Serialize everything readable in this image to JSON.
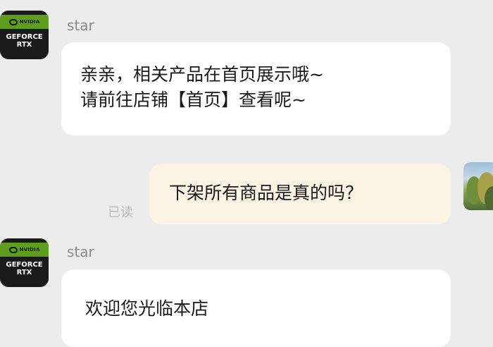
{
  "conversation": {
    "messages": [
      {
        "sender": "star",
        "avatar": "geforce-rtx-logo",
        "avatar_text": [
          "NVIDIA",
          "GEFORCE",
          "RTX"
        ],
        "lines": [
          "亲亲，相关产品在首页展示哦~",
          "请前往店铺【首页】查看呢~"
        ]
      },
      {
        "sender": "self",
        "avatar": "landscape-photo",
        "lines": [
          "下架所有商品是真的吗？"
        ],
        "status": "已读"
      },
      {
        "sender": "star",
        "avatar": "geforce-rtx-logo",
        "avatar_text": [
          "NVIDIA",
          "GEFORCE",
          "RTX"
        ],
        "lines": [
          "欢迎您光临本店"
        ]
      }
    ]
  },
  "colors": {
    "background": "#ececec",
    "incoming_bubble": "#ffffff",
    "outgoing_bubble": "#fbf4e4",
    "logo_green": "#5f9e1c",
    "sender_name": "#8a8a8a",
    "read_status": "#b9b9b9"
  }
}
